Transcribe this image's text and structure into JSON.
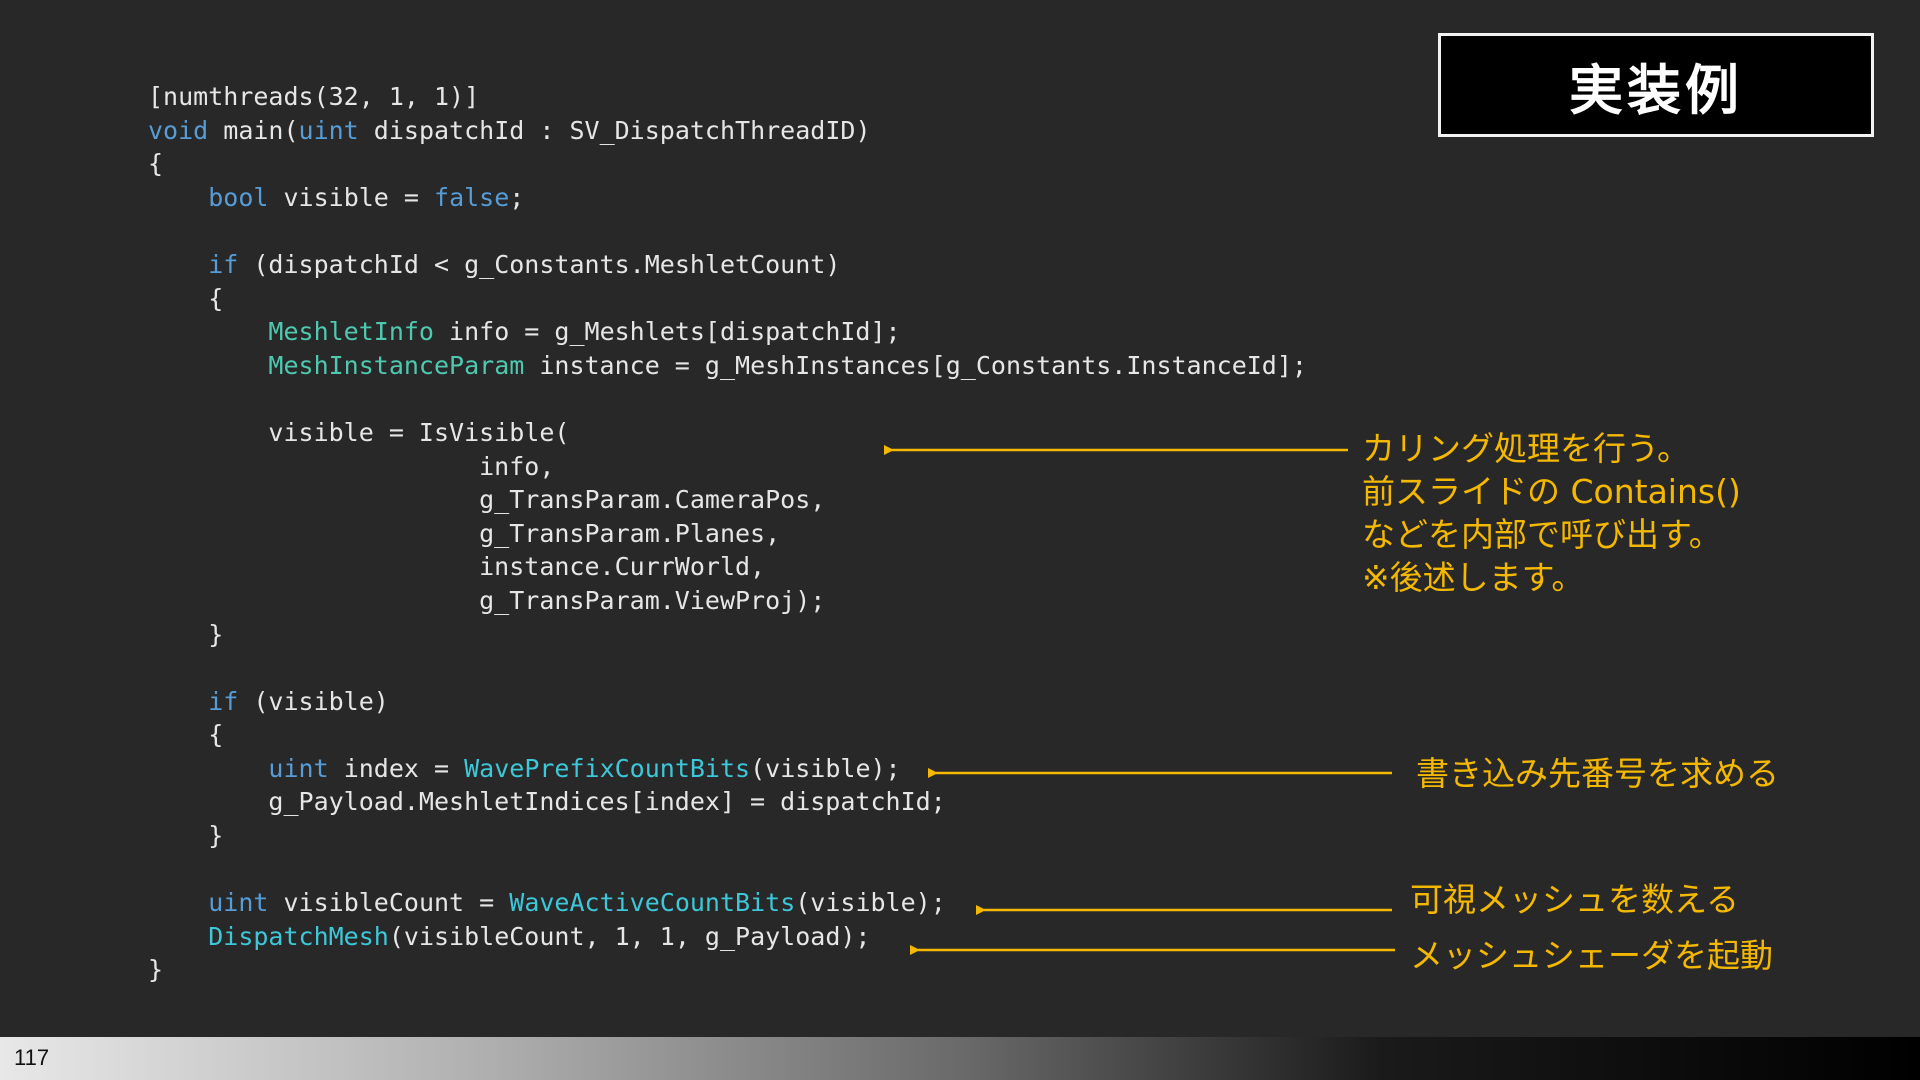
{
  "title": "実装例",
  "page_number": "117",
  "colors": {
    "background": "#282829",
    "keyword": "#569cd6",
    "type": "#4ec9b0",
    "function": "#3cc8d8",
    "annotation": "#f5b800"
  },
  "code_lines": [
    [
      {
        "t": "[numthreads(32, 1, 1)]",
        "c": ""
      }
    ],
    [
      {
        "t": "void",
        "c": "kw"
      },
      {
        "t": " main(",
        "c": ""
      },
      {
        "t": "uint",
        "c": "kw"
      },
      {
        "t": " dispatchId : SV_DispatchThreadID)",
        "c": ""
      }
    ],
    [
      {
        "t": "{",
        "c": ""
      }
    ],
    [
      {
        "t": "    ",
        "c": ""
      },
      {
        "t": "bool",
        "c": "kw"
      },
      {
        "t": " visible = ",
        "c": ""
      },
      {
        "t": "false",
        "c": "kw"
      },
      {
        "t": ";",
        "c": ""
      }
    ],
    [
      {
        "t": "",
        "c": ""
      }
    ],
    [
      {
        "t": "    ",
        "c": ""
      },
      {
        "t": "if",
        "c": "kw"
      },
      {
        "t": " (dispatchId < g_Constants.MeshletCount)",
        "c": ""
      }
    ],
    [
      {
        "t": "    {",
        "c": ""
      }
    ],
    [
      {
        "t": "        ",
        "c": ""
      },
      {
        "t": "MeshletInfo",
        "c": "ty"
      },
      {
        "t": " info = g_Meshlets[dispatchId];",
        "c": ""
      }
    ],
    [
      {
        "t": "        ",
        "c": ""
      },
      {
        "t": "MeshInstanceParam",
        "c": "ty"
      },
      {
        "t": " instance = g_MeshInstances[g_Constants.InstanceId];",
        "c": ""
      }
    ],
    [
      {
        "t": "",
        "c": ""
      }
    ],
    [
      {
        "t": "        visible = IsVisible(",
        "c": ""
      }
    ],
    [
      {
        "t": "                      info,",
        "c": ""
      }
    ],
    [
      {
        "t": "                      g_TransParam.CameraPos,",
        "c": ""
      }
    ],
    [
      {
        "t": "                      g_TransParam.Planes,",
        "c": ""
      }
    ],
    [
      {
        "t": "                      instance.CurrWorld,",
        "c": ""
      }
    ],
    [
      {
        "t": "                      g_TransParam.ViewProj);",
        "c": ""
      }
    ],
    [
      {
        "t": "    }",
        "c": ""
      }
    ],
    [
      {
        "t": "",
        "c": ""
      }
    ],
    [
      {
        "t": "    ",
        "c": ""
      },
      {
        "t": "if",
        "c": "kw"
      },
      {
        "t": " (visible)",
        "c": ""
      }
    ],
    [
      {
        "t": "    {",
        "c": ""
      }
    ],
    [
      {
        "t": "        ",
        "c": ""
      },
      {
        "t": "uint",
        "c": "kw"
      },
      {
        "t": " index = ",
        "c": ""
      },
      {
        "t": "WavePrefixCountBits",
        "c": "fn"
      },
      {
        "t": "(visible);",
        "c": ""
      }
    ],
    [
      {
        "t": "        g_Payload.MeshletIndices[index] = dispatchId;",
        "c": ""
      }
    ],
    [
      {
        "t": "    }",
        "c": ""
      }
    ],
    [
      {
        "t": "",
        "c": ""
      }
    ],
    [
      {
        "t": "    ",
        "c": ""
      },
      {
        "t": "uint",
        "c": "kw"
      },
      {
        "t": " visibleCount = ",
        "c": ""
      },
      {
        "t": "WaveActiveCountBits",
        "c": "fn"
      },
      {
        "t": "(visible);",
        "c": ""
      }
    ],
    [
      {
        "t": "    ",
        "c": ""
      },
      {
        "t": "DispatchMesh",
        "c": "fn"
      },
      {
        "t": "(visibleCount, 1, 1, g_Payload);",
        "c": ""
      }
    ],
    [
      {
        "t": "}",
        "c": ""
      }
    ]
  ],
  "annotations": {
    "culling": "カリング処理を行う。\n前スライドの Contains()\nなどを内部で呼び出す。\n※後述します。",
    "write_index": "書き込み先番号を求める",
    "count_visible": "可視メッシュを数える",
    "dispatch": "メッシュシェーダを起動"
  }
}
